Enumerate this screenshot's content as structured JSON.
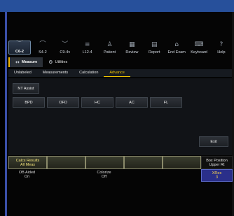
{
  "toolbar": {
    "items": [
      {
        "icon": "probe-c-icon",
        "glyph": "︶",
        "label": "C6-2",
        "selected": true
      },
      {
        "icon": "probe-s-icon",
        "glyph": "⌒",
        "label": "S4-2"
      },
      {
        "icon": "probe-c-icon",
        "glyph": "︶",
        "label": "C9-4v"
      },
      {
        "icon": "probe-l-icon",
        "glyph": "≡",
        "label": "L12-4"
      },
      {
        "icon": "patient-icon",
        "glyph": "♙",
        "label": "Patient"
      },
      {
        "icon": "review-icon",
        "glyph": "▦",
        "label": "Review"
      },
      {
        "icon": "report-icon",
        "glyph": "▤",
        "label": "Report"
      },
      {
        "icon": "end-exam-icon",
        "glyph": "⌂",
        "label": "End Exam"
      },
      {
        "icon": "keyboard-icon",
        "glyph": "⌨",
        "label": "Keyboard"
      },
      {
        "icon": "help-icon",
        "glyph": "?",
        "label": "Help"
      }
    ]
  },
  "modes": {
    "measure_label": "Measure",
    "utilities_label": "Utilities"
  },
  "subtabs": [
    "Unlabeled",
    "Measurements",
    "Calculation",
    "Advance"
  ],
  "buttons": {
    "nt_assist": "NT Assist",
    "bpd": "BPD",
    "ofd": "OFD",
    "hc": "HC",
    "ac": "AC",
    "fl": "FL",
    "exit": "Exit"
  },
  "softkeys": {
    "calcs_results_line1": "Calcs Results",
    "calcs_results_line2": "All Meas",
    "box_position_line1": "Box Position",
    "box_position_line2": "Upper Rt",
    "ob_aided_line1": "OB Aided",
    "ob_aided_line2": "On",
    "colorize_line1": "Colorize",
    "colorize_line2": "Off",
    "xres_line1": "XRes",
    "xres_line2": "3"
  }
}
